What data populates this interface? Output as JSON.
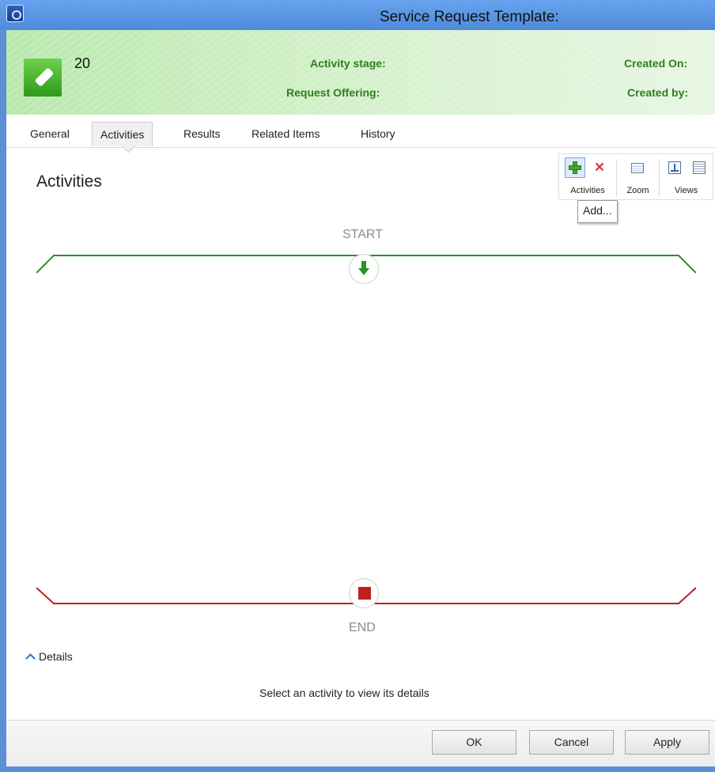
{
  "window": {
    "title": "Service Request Template:",
    "app_icon": "app-system-center-icon"
  },
  "header": {
    "number": "20",
    "activity_stage_label": "Activity stage:",
    "request_offering_label": "Request Offering:",
    "created_on_label": "Created On:",
    "created_by_label": "Created by:",
    "icon": "service-request-ticket-icon",
    "accent": "#2f7e1d"
  },
  "tabs": [
    {
      "label": "General",
      "active": false
    },
    {
      "label": "Activities",
      "active": true
    },
    {
      "label": "Results",
      "active": false
    },
    {
      "label": "Related Items",
      "active": false
    },
    {
      "label": "History",
      "active": false
    }
  ],
  "main": {
    "title": "Activities"
  },
  "ribbon": {
    "groups": [
      {
        "label": "Activities",
        "buttons": [
          {
            "icon": "add-icon"
          },
          {
            "icon": "delete-icon"
          }
        ]
      },
      {
        "label": "Zoom",
        "buttons": [
          {
            "icon": "zoom-icon"
          }
        ]
      },
      {
        "label": "Views",
        "buttons": [
          {
            "icon": "tree-view-icon"
          },
          {
            "icon": "list-view-icon"
          }
        ]
      }
    ]
  },
  "tooltip": {
    "text": "Add..."
  },
  "flow": {
    "start_label": "START",
    "end_label": "END",
    "start_color": "#2d8f26",
    "end_color": "#bf1f1f"
  },
  "details": {
    "toggle_label": "Details",
    "empty_text": "Select an activity to view its details"
  },
  "footer": {
    "ok_label": "OK",
    "cancel_label": "Cancel",
    "apply_label": "Apply"
  }
}
